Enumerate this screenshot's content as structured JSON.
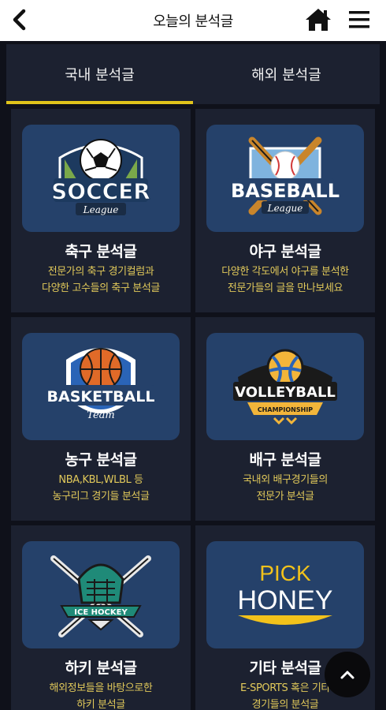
{
  "header": {
    "title": "오늘의 분석글",
    "back_icon": "chevron-left-icon",
    "home_icon": "home-icon",
    "menu_icon": "hamburger-menu-icon"
  },
  "tabs": [
    {
      "label": "국내 분석글",
      "active": true
    },
    {
      "label": "해외 분석글",
      "active": false
    }
  ],
  "cards": [
    {
      "title": "축구 분석글",
      "desc1": "전문가의 축구 경기컬럼과",
      "desc2": "다양한 고수들의 축구 분석글",
      "logo": {
        "main": "SOCCER",
        "sub": "League"
      }
    },
    {
      "title": "야구 분석글",
      "desc1": "다양한 각도에서 야구를 분석한",
      "desc2": "전문가들의 글을 만나보세요",
      "logo": {
        "main": "BASEBALL",
        "sub": "League"
      }
    },
    {
      "title": "농구 분석글",
      "desc1": "NBA,KBL,WLBL 등",
      "desc2": "농구리그 경기들 분석글",
      "logo": {
        "main": "BASKETBALL",
        "sub": "Team"
      }
    },
    {
      "title": "배구 분석글",
      "desc1": "국내외 배구경기들의",
      "desc2": "전문가 분석글",
      "logo": {
        "main": "VOLLEYBALL",
        "sub": "CHAMPIONSHIP"
      }
    },
    {
      "title": "하키 분석글",
      "desc1": "해외정보들을 바탕으로한",
      "desc2": "하키 분석글",
      "logo": {
        "main": "ICE HOCKEY",
        "sub": ""
      }
    },
    {
      "title": "기타 분석글",
      "desc1": "E-SPORTS 혹은 기타",
      "desc2": "경기들의 분석글",
      "logo": {
        "main": "PICK",
        "sub": "HONEY"
      }
    }
  ],
  "scroll_top_icon": "chevron-up-icon",
  "colors": {
    "background": "#0f111a",
    "card": "#1c2130",
    "thumb": "#25416a",
    "accent": "#e1c41b",
    "desc_text": "#e1c95a"
  }
}
